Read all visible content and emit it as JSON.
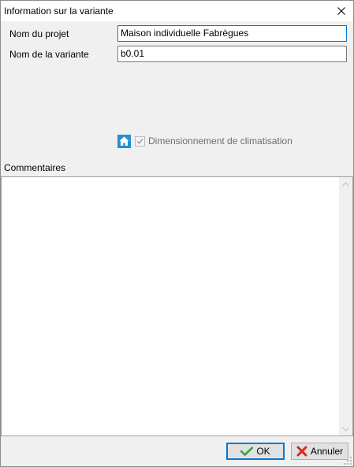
{
  "window": {
    "title": "Information sur la variante"
  },
  "form": {
    "project_name_label": "Nom du projet",
    "project_name_value": "Maison individuelle Fabrègues",
    "variant_name_label": "Nom de la variante",
    "variant_name_value": "b0.01"
  },
  "options": {
    "cooling_sizing_label": "Dimensionnement de climatisation",
    "cooling_sizing_checked": true,
    "cooling_sizing_enabled": false
  },
  "comments": {
    "label": "Commentaires",
    "value": ""
  },
  "buttons": {
    "ok_label": "OK",
    "cancel_label": "Annuler"
  },
  "icons": {
    "close": "close-icon",
    "home": "home-icon",
    "check": "check-icon",
    "ok": "green-check-icon",
    "cancel": "red-cross-icon"
  },
  "colors": {
    "window_bg": "#f0f0f0",
    "focus_border": "#0078d7",
    "home_icon": "#1e90d6",
    "ok_icon": "#3aa53a",
    "cancel_icon": "#d42a1e"
  }
}
